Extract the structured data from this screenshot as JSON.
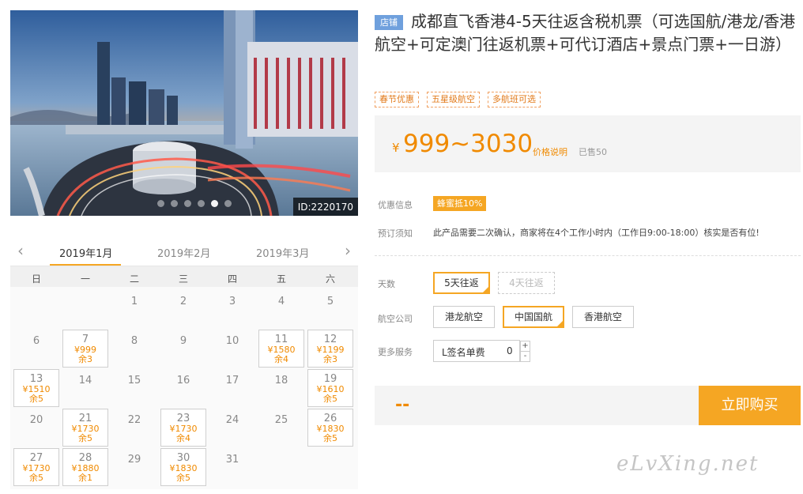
{
  "hero": {
    "image_id": "ID:2220170",
    "slide_count": 6,
    "active_slide": 4
  },
  "calendar": {
    "months": [
      "2019年1月",
      "2019年2月",
      "2019年3月"
    ],
    "active_month": 0,
    "weekdays": [
      "日",
      "一",
      "二",
      "三",
      "四",
      "五",
      "六"
    ],
    "days": [
      {
        "d": "1",
        "col": 2,
        "row": 0
      },
      {
        "d": "2",
        "col": 3,
        "row": 0
      },
      {
        "d": "3",
        "col": 4,
        "row": 0
      },
      {
        "d": "4",
        "col": 5,
        "row": 0
      },
      {
        "d": "5",
        "col": 6,
        "row": 0
      },
      {
        "d": "6",
        "col": 0,
        "row": 1
      },
      {
        "d": "7",
        "col": 1,
        "row": 1,
        "price": "¥999",
        "left": "余3"
      },
      {
        "d": "8",
        "col": 2,
        "row": 1
      },
      {
        "d": "9",
        "col": 3,
        "row": 1
      },
      {
        "d": "10",
        "col": 4,
        "row": 1
      },
      {
        "d": "11",
        "col": 5,
        "row": 1,
        "price": "¥1580",
        "left": "余4"
      },
      {
        "d": "12",
        "col": 6,
        "row": 1,
        "price": "¥1199",
        "left": "余3"
      },
      {
        "d": "13",
        "col": 0,
        "row": 2,
        "price": "¥1510",
        "left": "余5"
      },
      {
        "d": "14",
        "col": 1,
        "row": 2
      },
      {
        "d": "15",
        "col": 2,
        "row": 2
      },
      {
        "d": "16",
        "col": 3,
        "row": 2
      },
      {
        "d": "17",
        "col": 4,
        "row": 2
      },
      {
        "d": "18",
        "col": 5,
        "row": 2
      },
      {
        "d": "19",
        "col": 6,
        "row": 2,
        "price": "¥1610",
        "left": "余5"
      },
      {
        "d": "20",
        "col": 0,
        "row": 3
      },
      {
        "d": "21",
        "col": 1,
        "row": 3,
        "price": "¥1730",
        "left": "余5"
      },
      {
        "d": "22",
        "col": 2,
        "row": 3
      },
      {
        "d": "23",
        "col": 3,
        "row": 3,
        "price": "¥1730",
        "left": "余4"
      },
      {
        "d": "24",
        "col": 4,
        "row": 3
      },
      {
        "d": "25",
        "col": 5,
        "row": 3
      },
      {
        "d": "26",
        "col": 6,
        "row": 3,
        "price": "¥1830",
        "left": "余5"
      },
      {
        "d": "27",
        "col": 0,
        "row": 4,
        "price": "¥1730",
        "left": "余5"
      },
      {
        "d": "28",
        "col": 1,
        "row": 4,
        "price": "¥1880",
        "left": "余1"
      },
      {
        "d": "29",
        "col": 2,
        "row": 4
      },
      {
        "d": "30",
        "col": 3,
        "row": 4,
        "price": "¥1830",
        "left": "余5"
      },
      {
        "d": "31",
        "col": 4,
        "row": 4
      }
    ]
  },
  "product": {
    "shop_badge": "店铺",
    "title": "成都直飞香港4-5天往返含税机票（可选国航/港龙/香港航空+可定澳门往返机票+可代订酒店+景点门票+一日游）",
    "tags": [
      "春节优惠",
      "五星级航空",
      "多航班可选"
    ],
    "currency": "¥",
    "price_range": "999~3030",
    "price_note": "价格说明",
    "sold": "已售50"
  },
  "info": {
    "promo_label": "优惠信息",
    "promo_badge": "蜂蜜抵10%",
    "notice_label": "预订须知",
    "notice_text": "此产品需要二次确认，商家将在4个工作小时内（工作日9:00-18:00）核实是否有位!"
  },
  "options": {
    "days_label": "天数",
    "days": [
      {
        "label": "5天往返",
        "state": "selected"
      },
      {
        "label": "4天往返",
        "state": "disabled"
      }
    ],
    "airline_label": "航空公司",
    "airlines": [
      {
        "label": "港龙航空",
        "state": "normal"
      },
      {
        "label": "中国国航",
        "state": "selected"
      },
      {
        "label": "香港航空",
        "state": "normal"
      }
    ],
    "service_label": "更多服务",
    "service_name": "L签名单费",
    "service_qty": "0",
    "plus": "+",
    "minus": "-"
  },
  "checkout": {
    "total": "--",
    "buy_label": "立即购买"
  },
  "watermark": "eLvXing.net",
  "colors": {
    "accent": "#f5a623",
    "price": "#f08a00",
    "shop_badge": "#6fa0dd"
  }
}
